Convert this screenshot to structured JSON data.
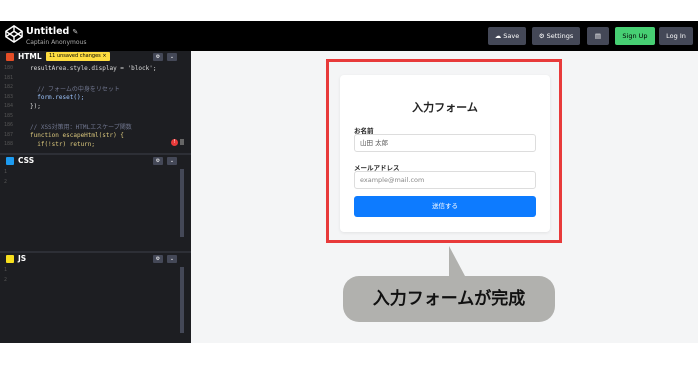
{
  "header": {
    "title": "Untitled",
    "subtitle": "Captain Anonymous",
    "buttons": {
      "save": "Save",
      "settings": "Settings",
      "signup": "Sign Up",
      "login": "Log In"
    }
  },
  "panels": {
    "html": {
      "label": "HTML",
      "badge": "11 unsaved changes ×",
      "lines": [
        {
          "num": "180",
          "text": "resultArea.style.display = 'block';"
        },
        {
          "num": "181",
          "text": ""
        },
        {
          "num": "182",
          "text": "  // フォームの中身をリセット"
        },
        {
          "num": "183",
          "text": "  form.reset();"
        },
        {
          "num": "184",
          "text": "});"
        },
        {
          "num": "185",
          "text": ""
        },
        {
          "num": "186",
          "text": "// XSS対策用：HTMLエスケープ関数"
        },
        {
          "num": "187",
          "text": "function escapeHtml(str) {"
        },
        {
          "num": "188",
          "text": "  if(!str) return;"
        }
      ]
    },
    "css": {
      "label": "CSS",
      "lines": [
        {
          "num": "1"
        },
        {
          "num": "2"
        }
      ]
    },
    "js": {
      "label": "JS",
      "lines": [
        {
          "num": "1"
        },
        {
          "num": "2"
        }
      ]
    }
  },
  "preview": {
    "form": {
      "title": "入力フォーム",
      "name_label": "お名前",
      "name_placeholder": "山田 太郎",
      "email_label": "メールアドレス",
      "email_placeholder": "example@mail.com",
      "submit_label": "送信する"
    },
    "callout": "入力フォームが完成"
  },
  "colors": {
    "highlight": "#e83a3a",
    "submit": "#0d7bff",
    "signup": "#47cf73",
    "callout": "#b1b1ae"
  }
}
